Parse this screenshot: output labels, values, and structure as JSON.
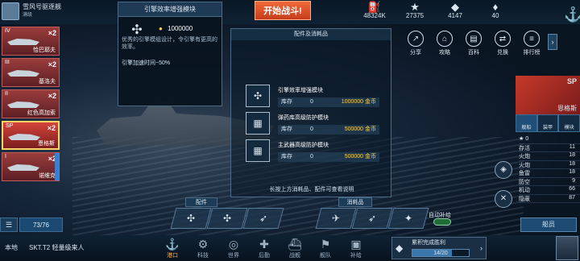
{
  "player": {
    "name": "雪风号驱逐舰",
    "level": "满级"
  },
  "battle_button": "开始战斗!",
  "resources": [
    {
      "icon": "oil-icon",
      "glyph": "⛽",
      "value": "48324K"
    },
    {
      "icon": "star-icon",
      "glyph": "★",
      "value": "27375"
    },
    {
      "icon": "diamond-icon",
      "glyph": "◆",
      "value": "4147"
    },
    {
      "icon": "gem-icon",
      "glyph": "♦",
      "value": "40"
    }
  ],
  "fleet": [
    {
      "tier": "IV",
      "mult": "×2",
      "name": "恰巴耶夫"
    },
    {
      "tier": "III",
      "mult": "×2",
      "name": "基洛夫"
    },
    {
      "tier": "II",
      "mult": "×2",
      "name": "红色高加索"
    },
    {
      "tier": "SP",
      "mult": "×2",
      "name": "恩格斯"
    },
    {
      "tier": "I",
      "mult": "×2",
      "name": "诺维克"
    }
  ],
  "fleet_count": "73/76",
  "tooltip": {
    "title": "引擎效率增强模块",
    "price": "1000000",
    "desc": "优秀的引擎模组设计，令引擎有更高的效率。",
    "effect": "引擎加速时间−50%"
  },
  "menu": [
    {
      "label": "分享",
      "glyph": "↗"
    },
    {
      "label": "攻略",
      "glyph": "⌂"
    },
    {
      "label": "百科",
      "glyph": "▤"
    },
    {
      "label": "兑换",
      "glyph": "⇄"
    },
    {
      "label": "排行榜",
      "glyph": "≡"
    }
  ],
  "parts_panel": {
    "header": "配件及消耗品",
    "stock_label": "库存",
    "items": [
      {
        "name": "引擎效率增强模块",
        "stock": "0",
        "price": "1000000 金币",
        "glyph": "✣"
      },
      {
        "name": "弹药库高级防护模块",
        "stock": "0",
        "price": "500000 金币",
        "glyph": "▦"
      },
      {
        "name": "主武器高级防护模块",
        "stock": "0",
        "price": "500000 金币",
        "glyph": "▦"
      }
    ],
    "footer": "长按上方消耗品、配件可查看说明"
  },
  "parts_tab": "配件",
  "consumables_tab": "消耗品",
  "auto_label": "自动补给",
  "ship": {
    "class": "SP",
    "name": "恩格斯"
  },
  "stat_tabs": [
    "舰船",
    "装甲",
    "模块"
  ],
  "stars": "0",
  "stats": [
    {
      "label": "存活",
      "value": "11"
    },
    {
      "label": "火炮",
      "value": "18"
    },
    {
      "label": "火炮",
      "value": "18"
    },
    {
      "label": "鱼雷",
      "value": "18"
    },
    {
      "label": "防空",
      "value": "9"
    },
    {
      "label": "机动",
      "value": "66"
    },
    {
      "label": "隐蔽",
      "value": "87"
    }
  ],
  "crew_button": "船员",
  "bottom": {
    "location": "本地",
    "notice": "SKT.T2 轻量级来人",
    "nav": [
      {
        "label": "港口",
        "glyph": "⚓",
        "active": true
      },
      {
        "label": "科技",
        "glyph": "⚙",
        "active": false
      },
      {
        "label": "世界",
        "glyph": "◎",
        "active": false
      },
      {
        "label": "后勤",
        "glyph": "✚",
        "active": false
      },
      {
        "label": "战舰",
        "glyph": "⛴",
        "active": false
      },
      {
        "label": "舰队",
        "glyph": "⚑",
        "active": false
      },
      {
        "label": "补给",
        "glyph": "▣",
        "active": false
      }
    ],
    "achievement": {
      "title": "累积完成胜利",
      "progress": "14/20",
      "ratio": 0.7
    }
  }
}
